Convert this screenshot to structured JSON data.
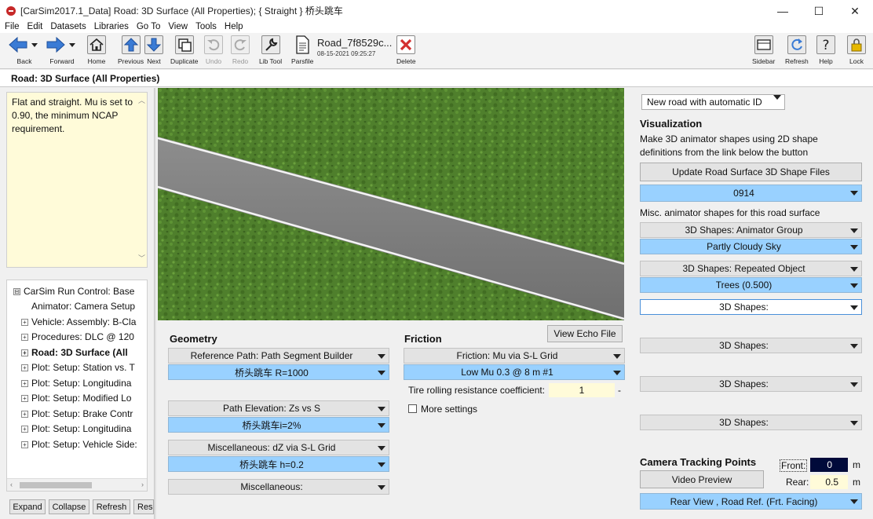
{
  "window": {
    "title": "[CarSim2017.1_Data] Road: 3D Surface (All Properties); { Straight } 桥头跳车",
    "minimize": "—",
    "maximize": "☐",
    "close": "✕"
  },
  "menu": [
    "File",
    "Edit",
    "Datasets",
    "Libraries",
    "Go To",
    "View",
    "Tools",
    "Help"
  ],
  "toolbar": {
    "back": "Back",
    "forward": "Forward",
    "home": "Home",
    "previous": "Previous",
    "next": "Next",
    "duplicate": "Duplicate",
    "undo": "Undo",
    "redo": "Redo",
    "lib_tool": "Lib Tool",
    "parsfile": "Parsfile",
    "parsfile_name": "Road_7f8529c...",
    "parsfile_date": "08-15-2021 09:25:27",
    "delete": "Delete",
    "sidebar": "Sidebar",
    "refresh": "Refresh",
    "help": "Help",
    "lock": "Lock"
  },
  "page": {
    "title": "Road: 3D Surface (All Properties)"
  },
  "notes": {
    "text": "Flat and straight. Mu is set to  0.90, the minimum NCAP requirement."
  },
  "tree": {
    "items": [
      {
        "label": "CarSim Run Control: Base",
        "pm": "⊟",
        "indent": 0,
        "bold": false
      },
      {
        "label": "Animator: Camera Setup",
        "pm": "",
        "indent": 1,
        "bold": false
      },
      {
        "label": "Vehicle: Assembly: B-Cla",
        "pm": "+",
        "indent": 1,
        "bold": false
      },
      {
        "label": "Procedures: DLC @ 120",
        "pm": "+",
        "indent": 1,
        "bold": false
      },
      {
        "label": "Road: 3D Surface (All",
        "pm": "+",
        "indent": 1,
        "bold": true
      },
      {
        "label": "Plot: Setup: Station vs. T",
        "pm": "+",
        "indent": 1,
        "bold": false
      },
      {
        "label": "Plot: Setup: Longitudina",
        "pm": "+",
        "indent": 1,
        "bold": false
      },
      {
        "label": "Plot: Setup: Modified Lo",
        "pm": "+",
        "indent": 1,
        "bold": false
      },
      {
        "label": "Plot: Setup: Brake Contr",
        "pm": "+",
        "indent": 1,
        "bold": false
      },
      {
        "label": "Plot: Setup: Longitudina",
        "pm": "+",
        "indent": 1,
        "bold": false
      },
      {
        "label": "Plot: Setup: Vehicle Side:",
        "pm": "+",
        "indent": 1,
        "bold": false
      }
    ]
  },
  "bottom_buttons": {
    "expand": "Expand",
    "collapse": "Collapse",
    "refresh": "Refresh",
    "reset": "Rese"
  },
  "geometry": {
    "title": "Geometry",
    "ref_path_label": "Reference Path: Path Segment Builder",
    "ref_path_value": "桥头跳车 R=1000",
    "elevation_label": "Path Elevation: Zs vs S",
    "elevation_value": "桥头跳车i=2%",
    "misc_label": "Miscellaneous: dZ via S-L Grid",
    "misc_value": "桥头跳车 h=0.2",
    "misc2_label": "Miscellaneous:"
  },
  "friction": {
    "title": "Friction",
    "view_echo": "View Echo File",
    "mu_label": "Friction: Mu via S-L Grid",
    "mu_value": "Low Mu 0.3 @ 8 m #1",
    "rolling_label": "Tire rolling resistance coefficient:",
    "rolling_value": "1",
    "rolling_unit": "-",
    "more_settings": "More settings"
  },
  "right": {
    "new_road": "New road with automatic ID",
    "vis_title": "Visualization",
    "vis_desc1": "Make 3D animator shapes using 2D shape",
    "vis_desc2": "definitions from the link below the button",
    "update_btn": "Update Road Surface 3D Shape Files",
    "shape_file": "0914",
    "misc_desc": "Misc. animator shapes for this road surface",
    "group_label": "3D Shapes: Animator Group",
    "group_value": "Partly Cloudy Sky",
    "repeat_label": "3D Shapes: Repeated Object",
    "repeat_value": "Trees (0.500)",
    "shapes1": "3D Shapes:",
    "shapes2": "3D Shapes:",
    "shapes3": "3D Shapes:",
    "shapes4": "3D Shapes:",
    "camera_title": "Camera Tracking Points",
    "front_label": "Front:",
    "front_value": "0",
    "front_unit": "m",
    "rear_label": "Rear:",
    "rear_value": "0.5",
    "rear_unit": "m",
    "video_preview": "Video Preview",
    "camera_view": "Rear View , Road Ref. (Frt. Facing)"
  }
}
